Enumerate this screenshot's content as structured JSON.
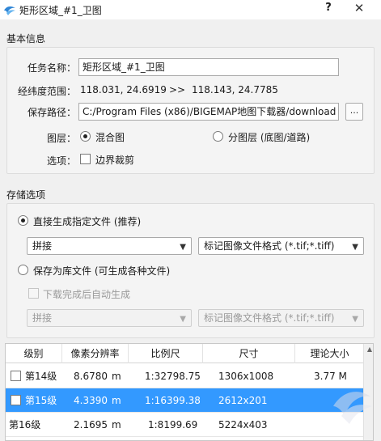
{
  "window": {
    "title": "矩形区域_#1_卫图",
    "help": "?",
    "close": "✕"
  },
  "basic": {
    "section_title": "基本信息",
    "task_name_label": "任务名称：",
    "task_name_value": "矩形区域_#1_卫图",
    "range_label": "经纬度范围：",
    "range_from": "118.031, 24.6919",
    "range_sep": ">>",
    "range_to": "118.143, 24.7785",
    "save_path_label": "保存路径：",
    "save_path_value": "C:/Program Files (x86)/BIGEMAP地图下载器/download",
    "browse_label": "...",
    "layer_label": "图层：",
    "layer_opt1": "混合图",
    "layer_opt2": "分图层 (底图/道路)",
    "options_label": "选项：",
    "clip_label": "边界裁剪"
  },
  "storage": {
    "section_title": "存储选项",
    "opt_direct": "直接生成指定文件 (推荐)",
    "direct_mode": "拼接",
    "direct_format": "标记图像文件格式 (*.tif;*.tiff)",
    "opt_library": "保存为库文件 (可生成各种文件)",
    "auto_gen": "下载完成后自动生成",
    "lib_mode": "拼接",
    "lib_format": "标记图像文件格式 (*.tif;*.tiff)"
  },
  "table": {
    "headers": [
      "级别",
      "像素分辨率",
      "比例尺",
      "尺寸",
      "理论大小"
    ],
    "rows": [
      {
        "level": "第14级",
        "res": "8.6780",
        "unit": "m",
        "scale": "1:32798.75",
        "size": "1306x1008",
        "est": "3.77 M"
      },
      {
        "level": "第15级",
        "res": "4.3390",
        "unit": "m",
        "scale": "1:16399.38",
        "size": "2612x201",
        "est": ""
      },
      {
        "level": "第16级",
        "res": "2.1695",
        "unit": "m",
        "scale": "1:8199.69",
        "size": "5224x403",
        "est": ""
      }
    ]
  },
  "colors": {
    "selection": "#3399ff",
    "window_bg": "#f0f0f0"
  }
}
